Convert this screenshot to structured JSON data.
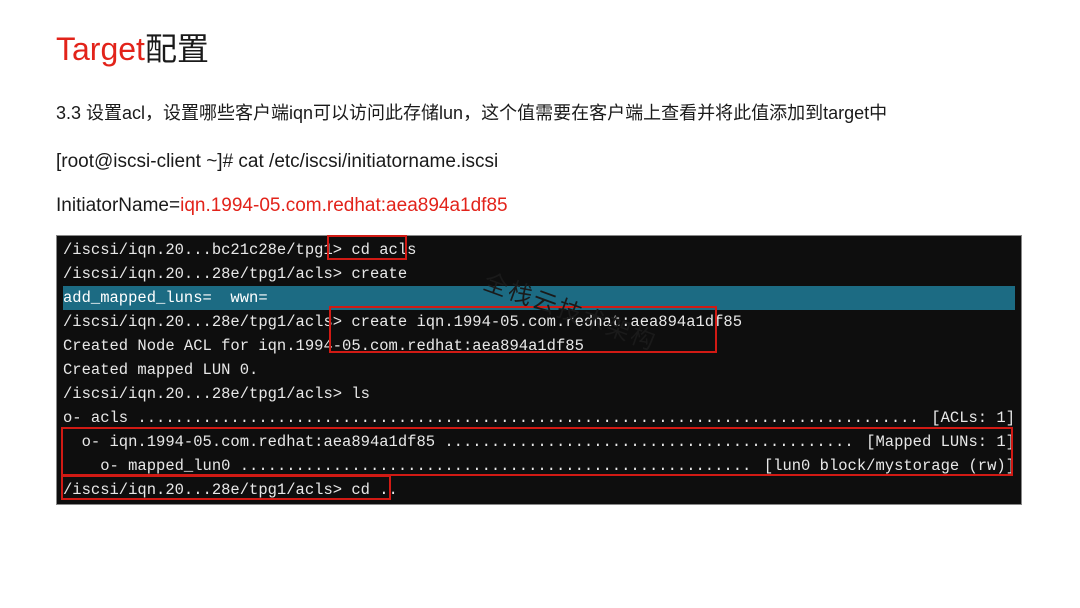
{
  "title_red": "Target",
  "title_black": "配置",
  "desc": "3.3 设置acl，设置哪些客户端iqn可以访问此存储lun，这个值需要在客户端上查看并将此值添加到target中",
  "cmdline": "[root@iscsi-client ~]# cat /etc/iscsi/initiatorname.iscsi",
  "init_label": "InitiatorName=",
  "init_value": "iqn.1994-05.com.redhat:aea894a1df85",
  "watermark": "全栈云技术架构",
  "term": {
    "l1_prompt": "/iscsi/iqn.20...bc21c28e/tpg1>",
    "l1_cmd": " cd acls ",
    "l2_prompt": "/iscsi/iqn.20...28e/tpg1/acls>",
    "l2_cmd": " create",
    "l3": "add_mapped_luns=  wwn=",
    "l4_prompt": "/iscsi/iqn.20...28e/tpg1/acls>",
    "l4_cmd": " create iqn.1994-05.com.redhat:aea894a1df85",
    "l5": "Created Node ACL for iqn.1994-05.com.redhat:aea894a1df85",
    "l6": "Created mapped LUN 0.",
    "l7_prompt": "/iscsi/iqn.20...28e/tpg1/acls>",
    "l7_cmd": " ls",
    "ls1_left": "o- acls ",
    "ls1_right": " [ACLs: 1]",
    "ls2_left": "  o- iqn.1994-05.com.redhat:aea894a1df85 ",
    "ls2_right": " [Mapped LUNs: 1]",
    "ls3_left": "    o- mapped_lun0 ",
    "ls3_right": " [lun0 block/mystorage (rw)]",
    "l11_prompt": "/iscsi/iqn.20...28e/tpg1/acls>",
    "l11_cmd": " cd .."
  }
}
